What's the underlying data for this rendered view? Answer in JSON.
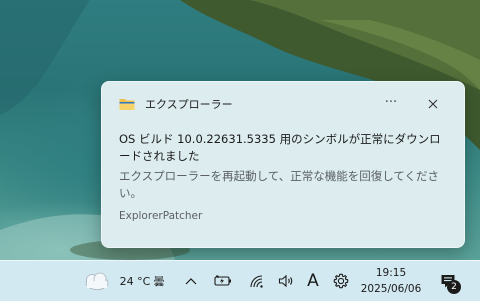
{
  "notification": {
    "app_name": "エクスプローラー",
    "more_label": "···",
    "title": "OS ビルド 10.0.22631.5335 用のシンボルが正常にダウンロードされました",
    "body": "エクスプローラーを再起動して、正常な機能を回復してください。",
    "source": "ExplorerPatcher",
    "app_icon": "folder-icon"
  },
  "taskbar": {
    "weather": {
      "icon": "partly-cloudy-icon",
      "temperature": "24 °C",
      "condition": "曇"
    },
    "tray_icons": [
      "chevron-up-icon",
      "battery-charging-icon",
      "wifi-icon",
      "volume-icon"
    ],
    "ime_indicator": "A",
    "settings_icon": "gear-icon",
    "clock": {
      "time": "19:15",
      "date": "2025/06/06"
    },
    "notification_center": {
      "icon": "notification-icon",
      "count": "2"
    }
  },
  "colors": {
    "toast_bg": "#dcecef",
    "taskbar_bg": "#d3e9f1",
    "folder_yellow": "#f2c04a"
  }
}
